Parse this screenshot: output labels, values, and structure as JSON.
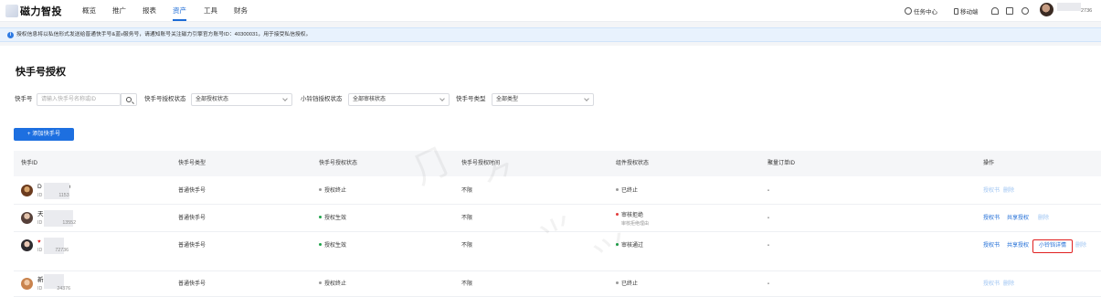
{
  "app": {
    "logo_text": "磁力智投"
  },
  "nav": {
    "items": [
      {
        "label": "概览"
      },
      {
        "label": "推广"
      },
      {
        "label": "报表"
      },
      {
        "label": "资产",
        "active": true
      },
      {
        "label": "工具"
      },
      {
        "label": "财务"
      }
    ],
    "right": {
      "task_center": "任务中心",
      "mobile": "移动端",
      "user_id_tail": "2736"
    }
  },
  "notice": {
    "text": "授权信息将以私信形式发送给普通快手号&蓝v服务号，请通知账号关注磁力引擎官方账号ID：40300031，用于接受私信授权。"
  },
  "page": {
    "title": "快手号授权"
  },
  "filters": {
    "account": {
      "label": "快手号",
      "placeholder": "请输入快手号名称或ID"
    },
    "auth_status": {
      "label": "快手号授权状态",
      "value": "全部授权状态"
    },
    "bell_status": {
      "label": "小铃铛授权状态",
      "value": "全部审核状态"
    },
    "account_type": {
      "label": "快手号类型",
      "value": "全部类型"
    }
  },
  "add_button": {
    "label": "+ 添加快手号"
  },
  "table": {
    "headers": [
      "快手ID",
      "快手号类型",
      "快手号授权状态",
      "快手号授权时间",
      "组件授权状态",
      "聚量订单ID",
      "操作"
    ],
    "rows": [
      {
        "name": "D",
        "name_tail": "e",
        "id": "ID",
        "id_tail": "1153",
        "type": "普通快手号",
        "auth_status": "授权终止",
        "auth_dot": "gray",
        "auth_time": "不限",
        "comp_status": "已终止",
        "comp_dot": "gray",
        "comp_sub": "",
        "order": "-",
        "actions": [
          "授权书",
          "删除"
        ]
      },
      {
        "name": "天",
        "name_tail": "",
        "id": "ID",
        "id_tail": "13552",
        "type": "普通快手号",
        "auth_status": "授权生效",
        "auth_dot": "green",
        "auth_time": "不限",
        "comp_status": "审核拒绝",
        "comp_dot": "red",
        "comp_sub": "审核拒绝理由",
        "order": "-",
        "actions": [
          "授权书",
          "共享授权",
          "删除"
        ]
      },
      {
        "name": "",
        "name_tail": "5",
        "id": "ID",
        "id_tail": "72736",
        "type": "普通快手号",
        "auth_status": "授权生效",
        "auth_dot": "green",
        "auth_time": "不限",
        "comp_status": "审核通过",
        "comp_dot": "green",
        "comp_sub": "",
        "order": "-",
        "actions": [
          "授权书",
          "共享授权",
          "小铃铛详情",
          "删除"
        ]
      },
      {
        "name": "新",
        "name_tail": "",
        "id": "ID",
        "id_tail": "24376",
        "type": "普通快手号",
        "auth_status": "授权终止",
        "auth_dot": "gray",
        "auth_time": "不限",
        "comp_status": "已终止",
        "comp_dot": "gray",
        "comp_sub": "",
        "order": "-",
        "actions": [
          "授权书",
          "删除"
        ]
      }
    ]
  },
  "colors": {
    "primary": "#1c6bd6",
    "danger": "#e02020",
    "success": "#1fa34a"
  }
}
